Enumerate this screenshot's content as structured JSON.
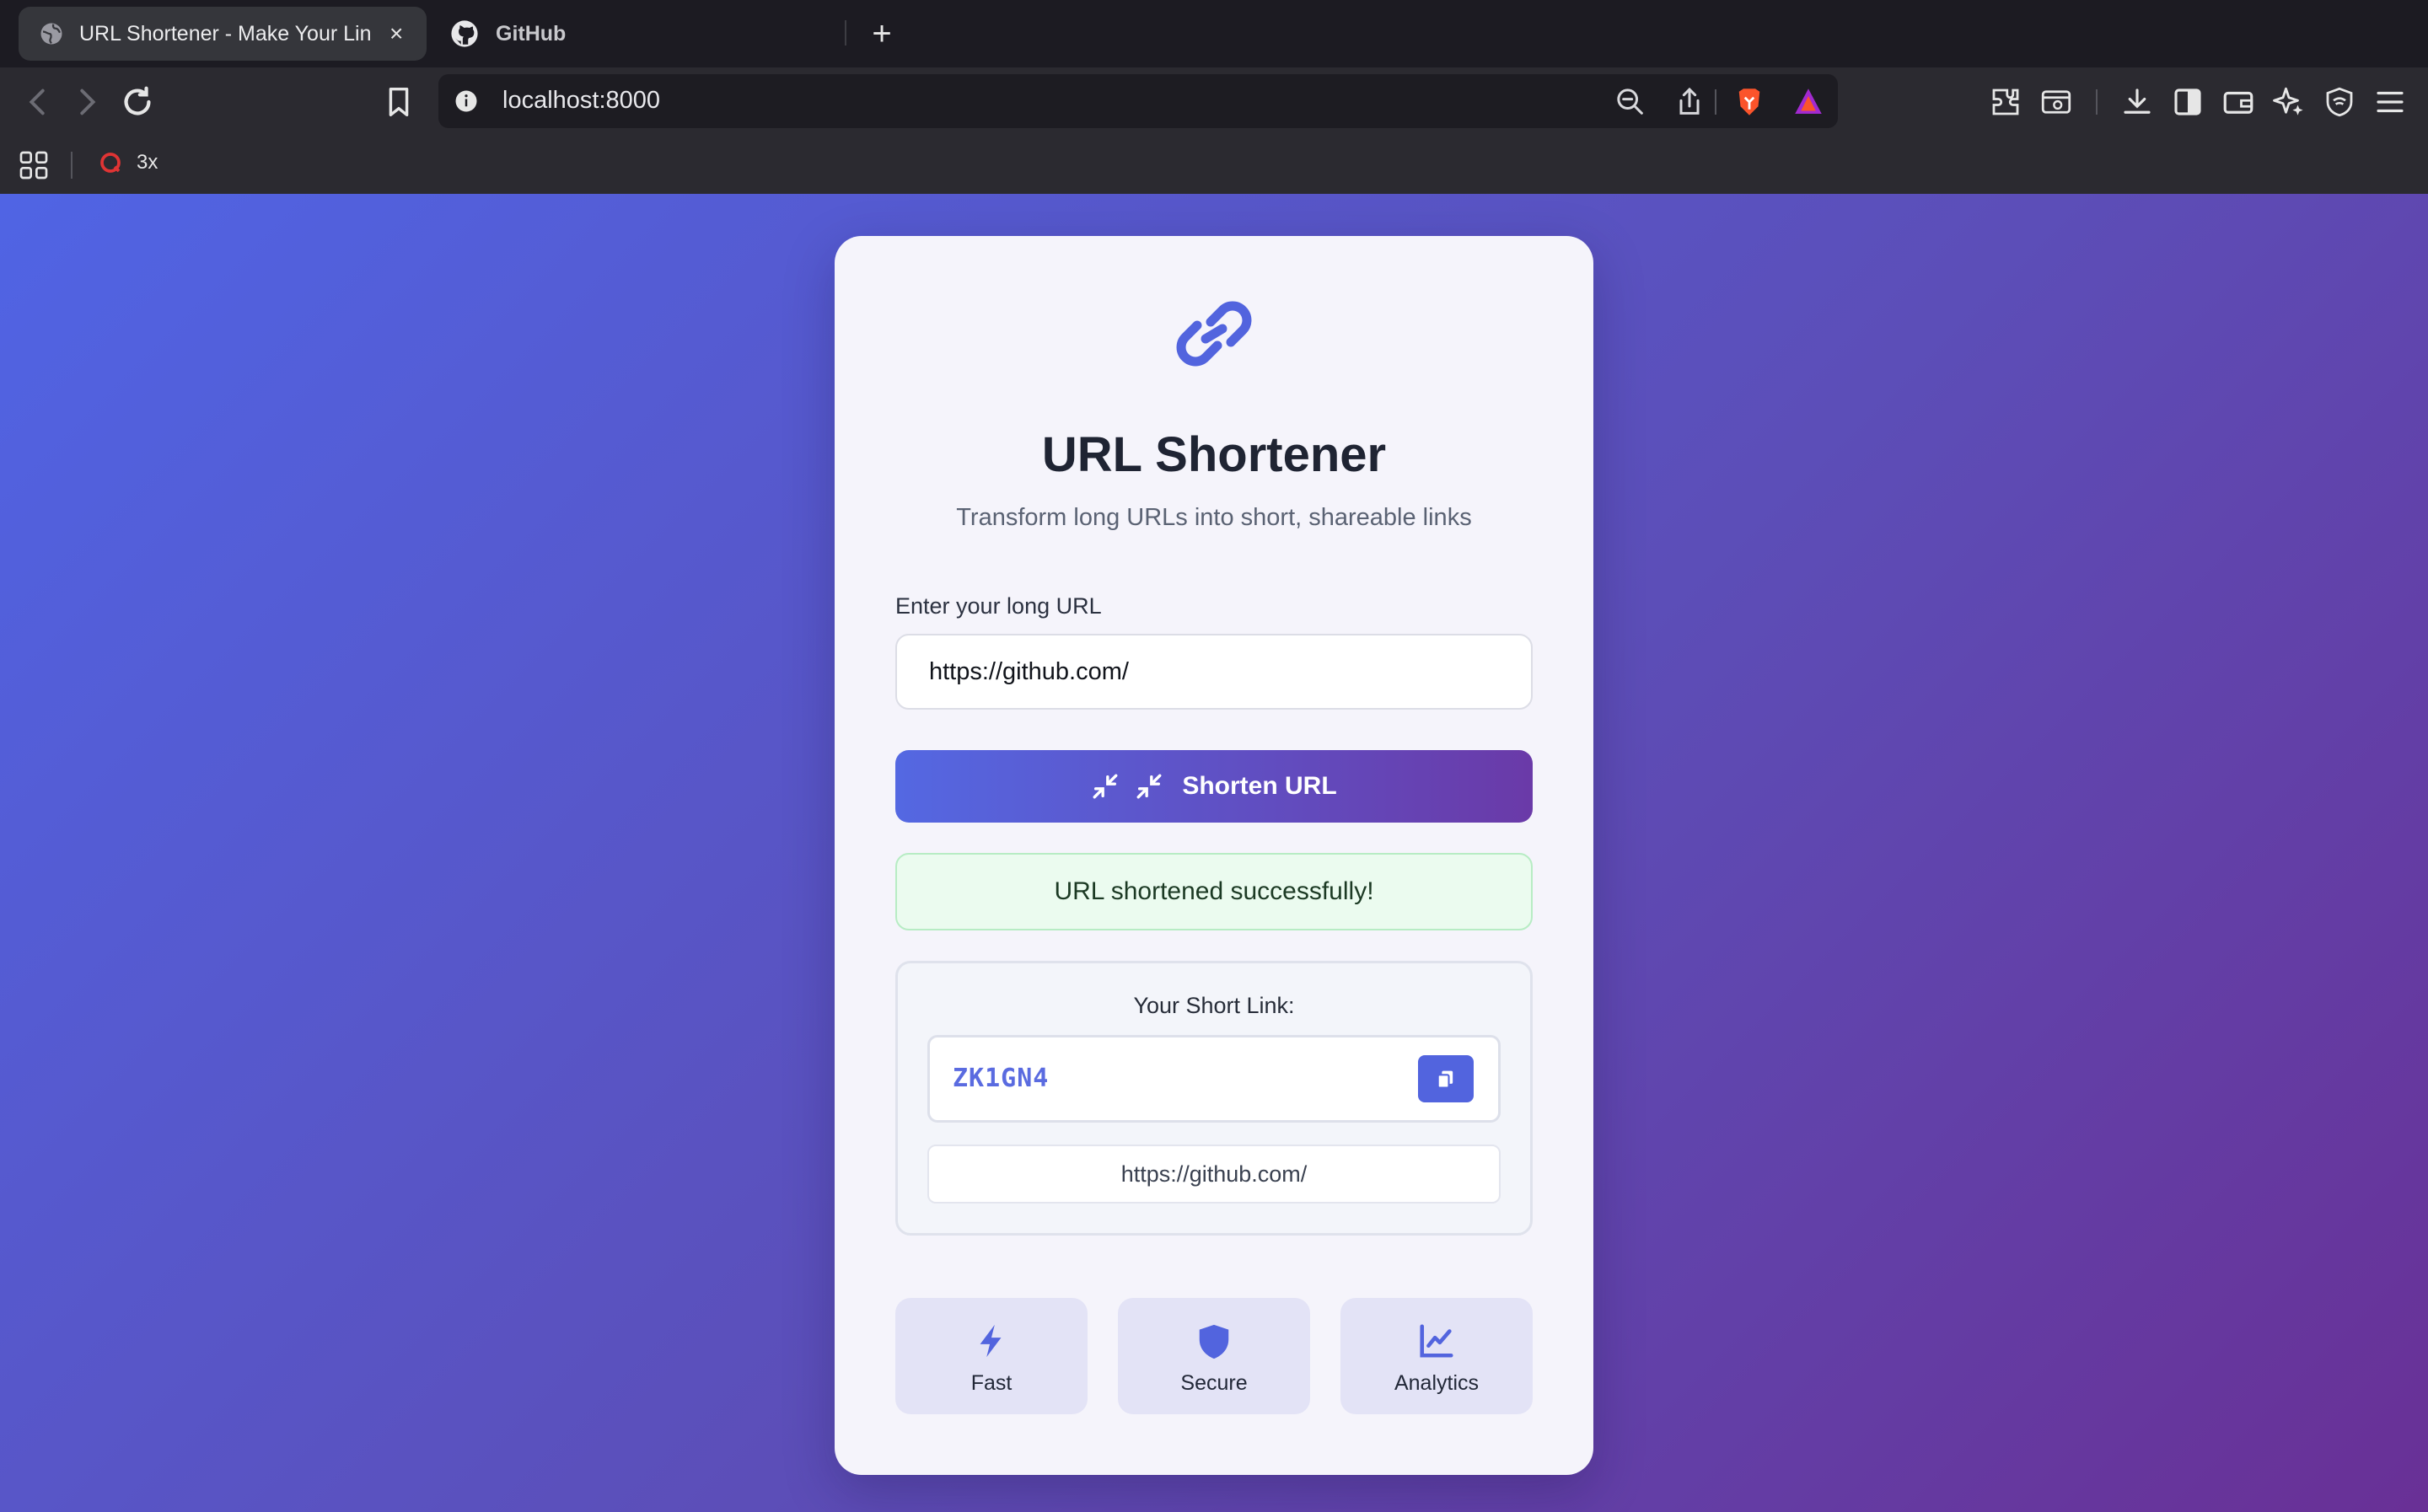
{
  "browser": {
    "tabs": [
      {
        "title": "URL Shortener - Make Your Lin",
        "active": true
      },
      {
        "title": "GitHub",
        "active": false
      }
    ],
    "new_tab_label": "+",
    "close_label": "×",
    "url": "localhost:8000",
    "bookmarks": [
      {
        "label": "3x"
      }
    ]
  },
  "app": {
    "title": "URL Shortener",
    "subtitle": "Transform long URLs into short, shareable links",
    "input_label": "Enter your long URL",
    "input_value": "https://github.com/",
    "button_label": "Shorten URL",
    "success_message": "URL shortened successfully!",
    "result": {
      "heading": "Your Short Link:",
      "code": "ZK1GN4",
      "original_url": "https://github.com/"
    },
    "features": [
      {
        "label": "Fast",
        "icon": "bolt-icon"
      },
      {
        "label": "Secure",
        "icon": "shield-icon"
      },
      {
        "label": "Analytics",
        "icon": "chart-line-icon"
      }
    ]
  },
  "colors": {
    "accent": "#5264de",
    "gradient_start": "#5064e4",
    "gradient_end": "#693096",
    "success_bg": "#ebfbef"
  }
}
